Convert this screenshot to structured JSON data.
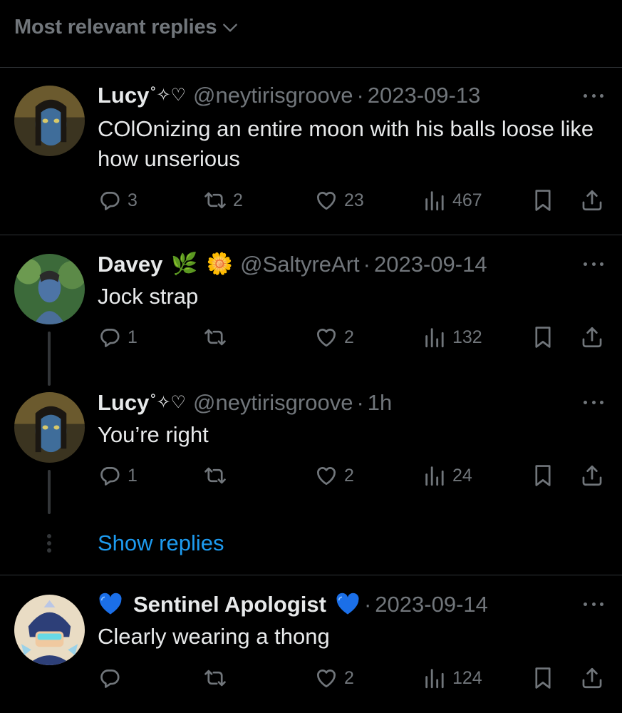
{
  "header": {
    "sort_label": "Most relevant replies"
  },
  "replies": [
    {
      "name": "Lucy",
      "name_deco": "˚✧♡",
      "handle": "@neytirisgroove",
      "separator": "·",
      "date": "2023-09-13",
      "text": "COlOnizing an entire moon with his balls loose like how unserious",
      "stats": {
        "replies": "3",
        "retweets": "2",
        "likes": "23",
        "views": "467"
      }
    },
    {
      "name": "Davey",
      "name_emoji_1": "🌿",
      "name_emoji_2": "🌼",
      "handle": "@SaltyreArt",
      "separator": "·",
      "date": "2023-09-14",
      "text": "Jock strap",
      "stats": {
        "replies": "1",
        "retweets": "",
        "likes": "2",
        "views": "132"
      }
    },
    {
      "name": "Lucy",
      "name_deco": "˚✧♡",
      "handle": "@neytirisgroove",
      "separator": "·",
      "date": "1h",
      "text": "You’re right",
      "stats": {
        "replies": "1",
        "retweets": "",
        "likes": "2",
        "views": "24"
      }
    },
    {
      "name": "Sentinel Apologist",
      "handle": "",
      "separator": "·",
      "date": "2023-09-14",
      "text": "Clearly wearing a thong",
      "stats": {
        "replies": "",
        "retweets": "",
        "likes": "2",
        "views": "124"
      }
    }
  ],
  "show_replies_label": "Show replies",
  "icons": [
    "chevron-down-icon",
    "more-icon",
    "reply-icon",
    "retweet-icon",
    "like-icon",
    "views-icon",
    "bookmark-icon",
    "share-icon",
    "blue-heart-icon"
  ],
  "colors": {
    "background": "#000000",
    "text": "#e7e9ea",
    "muted": "#71767b",
    "link": "#1d9bf0",
    "divider": "#2f3336"
  }
}
